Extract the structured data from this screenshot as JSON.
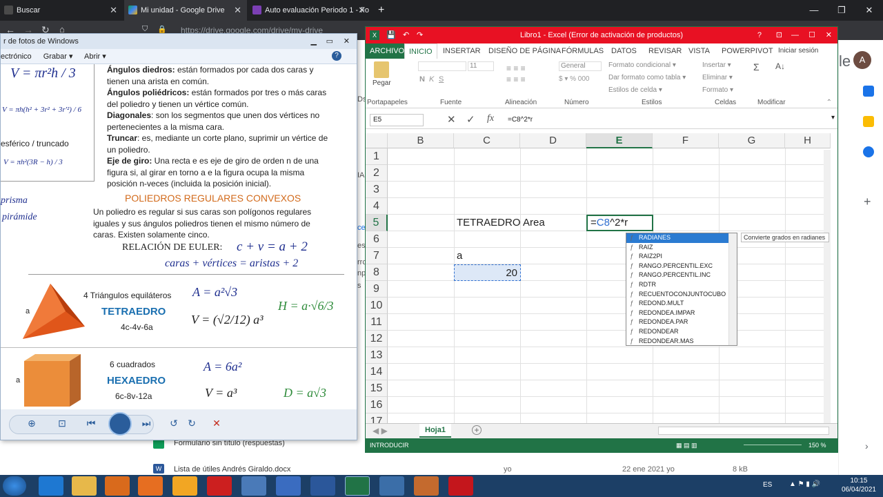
{
  "browser": {
    "tabs": [
      {
        "label": "Buscar",
        "active": false
      },
      {
        "label": "Mi unidad - Google Drive",
        "active": true
      },
      {
        "label": "Auto evaluación Periodo 1 - Fo",
        "active": false
      }
    ],
    "new_tab": "+",
    "url": "https://drive.google.com/drive/my-drive",
    "account_initial": "A",
    "brand_fragment": "le"
  },
  "drive": {
    "side_fragments": [
      "Ds",
      "IA",
      "ce",
      "es",
      "rrc",
      "npo",
      "s"
    ],
    "files": [
      {
        "name": "Formulario sin título (respuestas)",
        "owner": "",
        "date": "",
        "size": ""
      },
      {
        "name": "Lista de útiles Andrés Giraldo.docx",
        "owner": "yo",
        "date": "22 ene 2021 yo",
        "size": "8 kB"
      }
    ]
  },
  "viewer": {
    "title": "r de fotos de Windows",
    "menu": [
      "ectrónico",
      "Grabar ▾",
      "Abrir ▾"
    ],
    "left_formulas": {
      "v_top": "V = πr²h / 3",
      "v_frustum": "V = πh(h² + 3r² + 3r'²) / 6",
      "label": "esférico / truncado",
      "v_cap": "V = πh²(3R − h) / 3",
      "prisma": "prisma",
      "piramide": "pirámide"
    },
    "definitions": [
      {
        "term": "Ángulos diedros:",
        "text": " están formados por cada dos caras y tienen una arista en común."
      },
      {
        "term": "Ángulos poliédricos:",
        "text": " están formados por tres o más caras del poliedro y tienen un vértice común."
      },
      {
        "term": "Diagonales",
        "text": ": son los segmentos que unen dos vértices no pertenecientes a la misma cara."
      },
      {
        "term": "Truncar",
        "text": ": es, mediante un corte plano, suprimir un vértice de un poliedro."
      },
      {
        "term": "Eje de giro:",
        "text": " Una recta e es eje de giro de orden n de una figura si, al girar en torno a e la figura ocupa la misma posición n-veces (incluida la posición inicial)."
      }
    ],
    "section_title": "POLIEDROS REGULARES CONVEXOS",
    "section_text": "Un poliedro es regular si sus caras son polígonos regulares iguales y sus ángulos poliedros tienen el mismo número de caras. Existen solamente cinco.",
    "euler_title": "RELACIÓN DE EULER:",
    "euler_formula": "c + v = a + 2",
    "euler_words": "caras + vértices = aristas + 2",
    "solids": [
      {
        "faces": "4 Triángulos equiláteros",
        "name": "TETRAEDRO",
        "counts": "4c-4v-6a",
        "area": "A = a²√3",
        "volume": "V = (√2/12) a³",
        "extra": "H = a·√6/3",
        "side_label": "a"
      },
      {
        "faces": "6 cuadrados",
        "name": "HEXAEDRO",
        "counts": "6c-8v-12a",
        "area": "A = 6a²",
        "volume": "V = a³",
        "extra": "D = a√3",
        "side_label": "a"
      }
    ]
  },
  "excel": {
    "title": "Libro1 - Excel (Error de activación de productos)",
    "help": "?",
    "file_tab": "ARCHIVO",
    "tabs": [
      "INICIO",
      "INSERTAR",
      "DISEÑO DE PÁGINA",
      "FÓRMULAS",
      "DATOS",
      "REVISAR",
      "VISTA",
      "POWERPIVOT"
    ],
    "signin": "Iniciar sesión",
    "ribbon": {
      "paste": "Pegar",
      "font_size": "11",
      "number_format": "General",
      "conditional": "Formato condicional ▾",
      "as_table": "Dar formato como tabla ▾",
      "cell_styles": "Estilos de celda ▾",
      "insert": "Insertar ▾",
      "delete": "Eliminar ▾",
      "format": "Formato ▾",
      "groups": [
        "Portapapeles",
        "Fuente",
        "Alineación",
        "Número",
        "Estilos",
        "Celdas",
        "Modificar"
      ]
    },
    "name_box": "E5",
    "formula": "=C8^2*r",
    "columns": [
      "B",
      "C",
      "D",
      "E",
      "F",
      "G",
      "H"
    ],
    "rows": [
      "1",
      "2",
      "3",
      "4",
      "5",
      "6",
      "7",
      "8",
      "9",
      "10",
      "11",
      "12",
      "13",
      "14",
      "15",
      "16",
      "17"
    ],
    "cells": {
      "c5": "TETRAEDRO",
      "d5": "Area",
      "e5_prefix": "=",
      "e5_ref": "C8",
      "e5_suffix": "^2*r",
      "c7": "a",
      "c8": "20"
    },
    "autocomplete": [
      "RADIANES",
      "RAIZ",
      "RAIZ2PI",
      "RANGO.PERCENTIL.EXC",
      "RANGO.PERCENTIL.INC",
      "RDTR",
      "RECUENTOCONJUNTOCUBO",
      "REDOND.MULT",
      "REDONDEA.IMPAR",
      "REDONDEA.PAR",
      "REDONDEAR",
      "REDONDEAR.MAS"
    ],
    "tooltip": "Convierte grados en radianes",
    "sheet_tab": "Hoja1",
    "status": "INTRODUCIR",
    "zoom": "150 %"
  },
  "taskbar": {
    "lang": "ES",
    "time": "10:15",
    "date": "06/04/2021"
  },
  "colors": {
    "excel_green": "#217346",
    "excel_red_title": "#e81123",
    "ref_blue": "#2f6fd0"
  }
}
